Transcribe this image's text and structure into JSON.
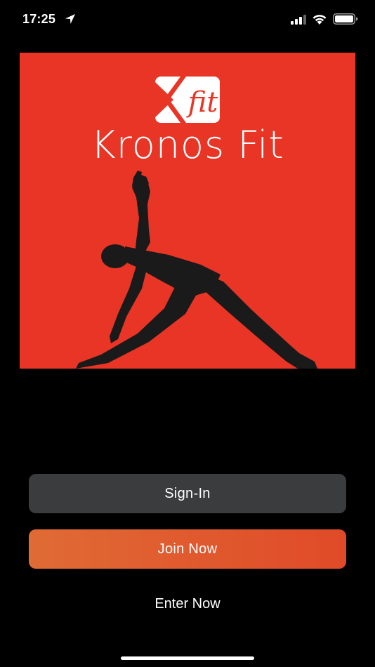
{
  "status_bar": {
    "time": "17:25",
    "icons": [
      "location-arrow-icon",
      "cellular-signal-icon",
      "wifi-icon",
      "battery-icon"
    ]
  },
  "hero": {
    "background_color": "#e83526",
    "logo_text": "fit",
    "brand_name": "Kronos Fit",
    "image": "yoga-triangle-pose-silhouette"
  },
  "buttons": {
    "sign_in": "Sign-In",
    "join_now": "Join Now",
    "enter_now": "Enter Now"
  },
  "colors": {
    "sign_in_bg": "#3a3c3d",
    "join_gradient_start": "#e06b35",
    "join_gradient_end": "#e04a28",
    "page_bg": "#000000"
  }
}
